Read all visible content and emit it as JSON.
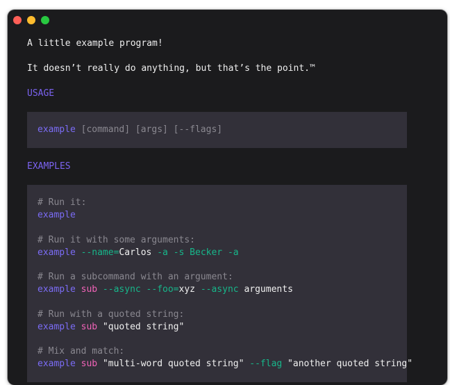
{
  "window": {
    "controls": [
      "close",
      "minimize",
      "maximize"
    ]
  },
  "intro": {
    "line1": "A little example program!",
    "line2": "It doesn’t really do anything, but that’s the point.™"
  },
  "usage": {
    "heading": "USAGE",
    "program": "example",
    "args": " [command] [args] [--flags]"
  },
  "examples": {
    "heading": "EXAMPLES",
    "ex1": {
      "comment": "# Run it:",
      "program": "example"
    },
    "ex2": {
      "comment": "# Run it with some arguments:",
      "program": "example",
      "flag_name": " --name=",
      "name_value": "Carlos",
      "flags": " -a -s Becker -a"
    },
    "ex3": {
      "comment": "# Run a subcommand with an argument:",
      "program": "example",
      "sub": " sub",
      "flag_async": " --async --foo=",
      "foo_value": "xyz",
      "flag_async2": " --async",
      "arguments": " arguments"
    },
    "ex4": {
      "comment": "# Run with a quoted string:",
      "program": "example",
      "sub": " sub",
      "string": " \"quoted string\""
    },
    "ex5": {
      "comment": "# Mix and match:",
      "program": "example",
      "sub": " sub",
      "string1": " \"multi-word quoted string\"",
      "flag": " --flag",
      "string2": " \"another quoted string\""
    }
  }
}
